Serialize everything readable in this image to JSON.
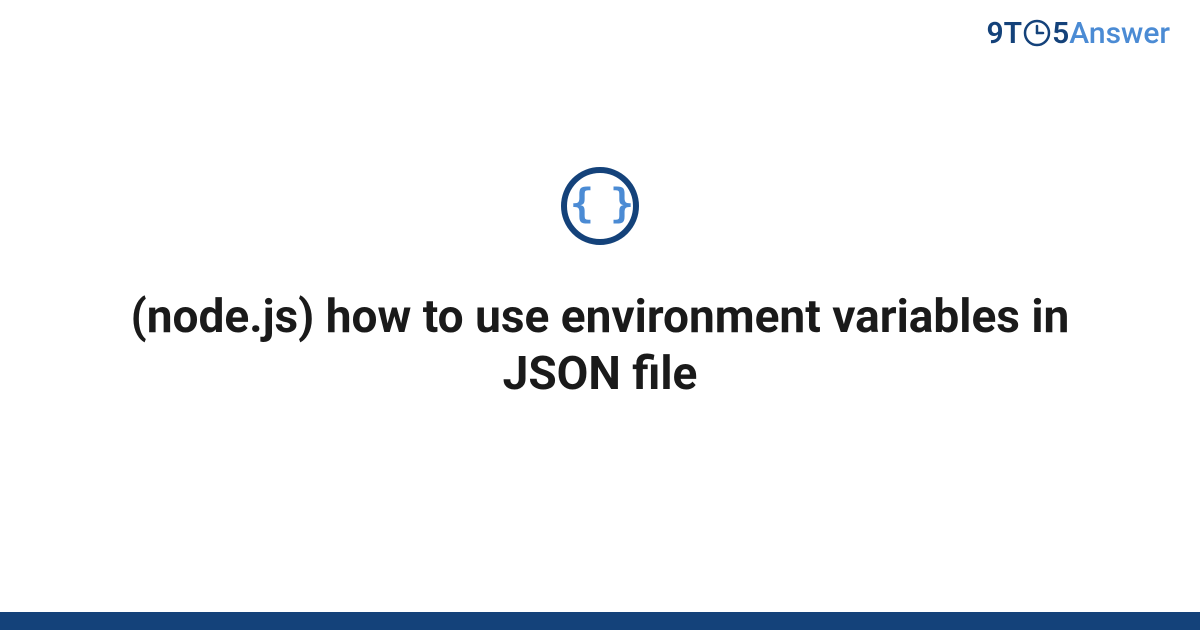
{
  "logo": {
    "part1": "9T",
    "part2": "5",
    "part3": "Answer"
  },
  "icon": {
    "name": "json-braces-icon",
    "glyph": "{ }"
  },
  "title": "(node.js) how to use environment variables in JSON file",
  "colors": {
    "darkBlue": "#14427a",
    "lightBlue": "#4b8bd4"
  }
}
